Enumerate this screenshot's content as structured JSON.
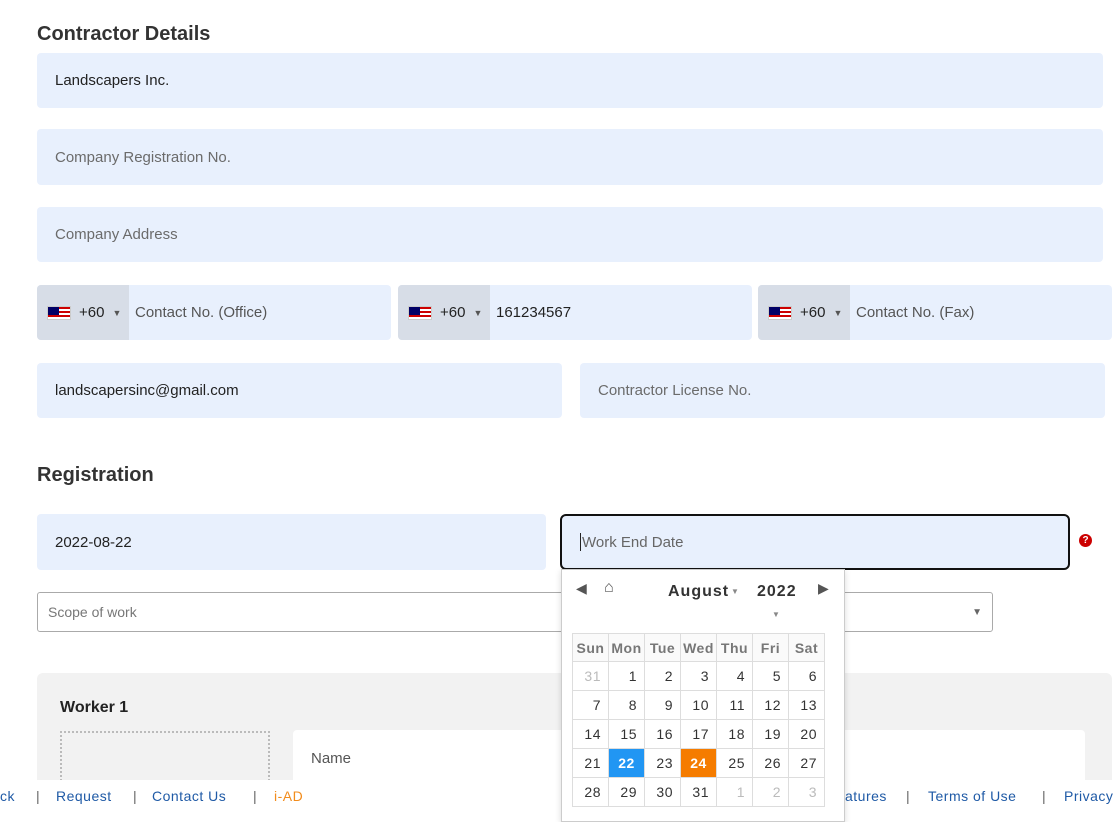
{
  "contractor": {
    "heading": "Contractor Details",
    "company_name": "Landscapers Inc.",
    "reg_no_placeholder": "Company Registration No.",
    "address_placeholder": "Company Address",
    "office_phone": {
      "code": "+60",
      "placeholder": "Contact No. (Office)"
    },
    "mobile_phone": {
      "code": "+60",
      "value": "161234567"
    },
    "fax_phone": {
      "code": "+60",
      "placeholder": "Contact No. (Fax)"
    },
    "email": "landscapersinc@gmail.com",
    "license_placeholder": "Contractor License No."
  },
  "registration": {
    "heading": "Registration",
    "start_date": "2022-08-22",
    "end_date_placeholder": "Work End Date",
    "help_glyph": "?",
    "scope_placeholder": "Scope of work"
  },
  "worker": {
    "title": "Worker 1",
    "name_placeholder": "Name"
  },
  "datepicker": {
    "month": "August",
    "year": "2022",
    "weekdays": [
      "Sun",
      "Mon",
      "Tue",
      "Wed",
      "Thu",
      "Fri",
      "Sat"
    ],
    "weeks": [
      [
        "31",
        "1",
        "2",
        "3",
        "4",
        "5",
        "6"
      ],
      [
        "7",
        "8",
        "9",
        "10",
        "11",
        "12",
        "13"
      ],
      [
        "14",
        "15",
        "16",
        "17",
        "18",
        "19",
        "20"
      ],
      [
        "21",
        "22",
        "23",
        "24",
        "25",
        "26",
        "27"
      ],
      [
        "28",
        "29",
        "30",
        "31",
        "1",
        "2",
        "3"
      ]
    ],
    "today": "22",
    "selected": "24",
    "colors": {
      "today": "#2196f3",
      "selected": "#f57c00"
    }
  },
  "footer": {
    "left_cut": "ck",
    "links": [
      "Request",
      "Contact Us"
    ],
    "brand": "i-AD",
    "right_cut": "atures",
    "right_links": [
      "Terms of Use",
      "Privacy"
    ],
    "separator": "|"
  },
  "colors": {
    "field_bg": "#e8f0fd",
    "link": "#1f5aa6",
    "brand": "#f28c1c"
  }
}
